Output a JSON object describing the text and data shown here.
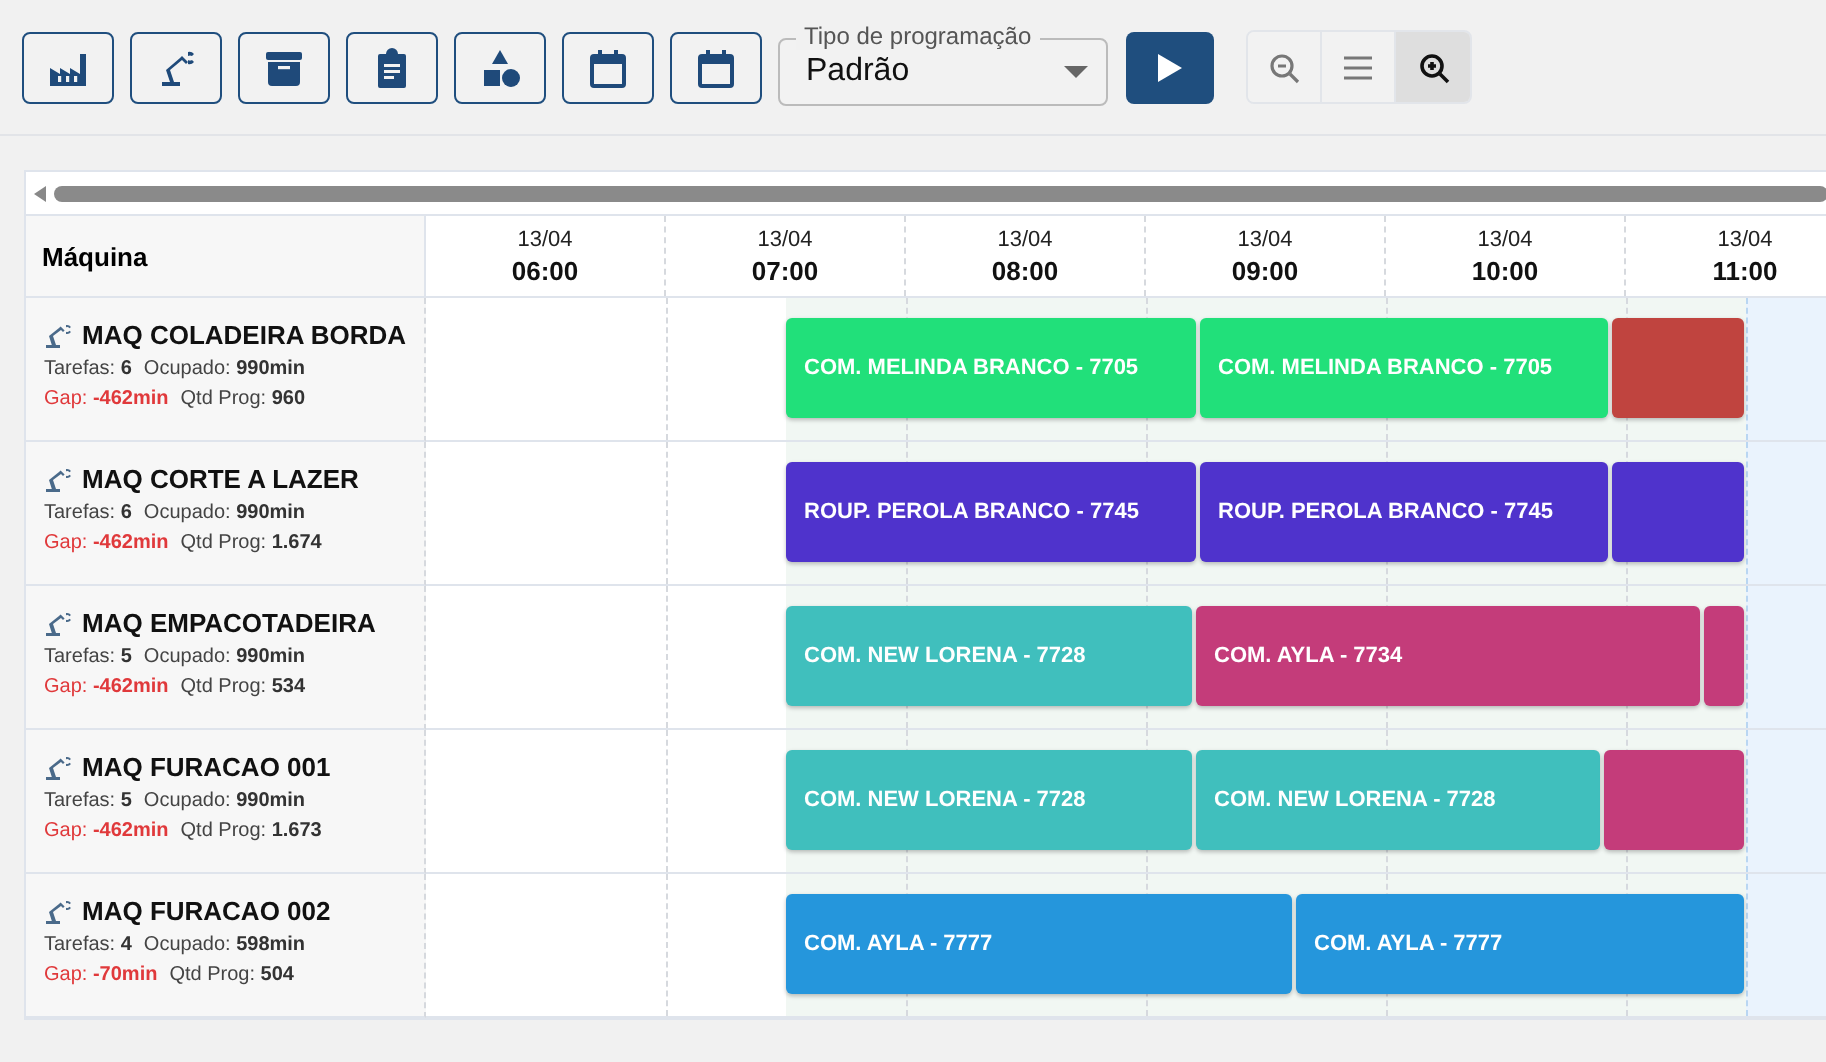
{
  "toolbar": {
    "select": {
      "label": "Tipo de programação",
      "value": "Padrão"
    },
    "zoom": [
      {
        "selected": false
      },
      {
        "selected": false
      },
      {
        "selected": true
      }
    ]
  },
  "gantt": {
    "column_header": "Máquina",
    "times": [
      {
        "date": "13/04",
        "time": "06:00"
      },
      {
        "date": "13/04",
        "time": "07:00"
      },
      {
        "date": "13/04",
        "time": "08:00"
      },
      {
        "date": "13/04",
        "time": "09:00"
      },
      {
        "date": "13/04",
        "time": "10:00"
      },
      {
        "date": "13/04",
        "time": "11:00"
      }
    ],
    "rows": [
      {
        "name": "MAQ COLADEIRA BORDA",
        "stats": [
          {
            "label": "Tarefas:",
            "value": "6",
            "alert": false
          },
          {
            "label": "Ocupado:",
            "value": "990min",
            "alert": false
          },
          {
            "label": "Gap:",
            "value": "-462min",
            "alert": true
          },
          {
            "label": "Qtd Prog:",
            "value": "960",
            "alert": false
          }
        ],
        "tasks": [
          {
            "label": "COM. MELINDA BRANCO - 7705",
            "color": "#21e07a"
          },
          {
            "label": "COM. MELINDA BRANCO - 7705",
            "color": "#21e07a"
          },
          {
            "color": "#c0443f"
          }
        ]
      },
      {
        "name": "MAQ CORTE A LAZER",
        "stats": [
          {
            "label": "Tarefas:",
            "value": "6",
            "alert": false
          },
          {
            "label": "Ocupado:",
            "value": "990min",
            "alert": false
          },
          {
            "label": "Gap:",
            "value": "-462min",
            "alert": true
          },
          {
            "label": "Qtd Prog:",
            "value": "1.674",
            "alert": false
          }
        ],
        "tasks": [
          {
            "label": "ROUP. PEROLA BRANCO - 7745",
            "color": "#4f33cc"
          },
          {
            "label": "ROUP. PEROLA BRANCO - 7745",
            "color": "#4f33cc"
          },
          {
            "color": "#4f33cc"
          }
        ]
      },
      {
        "name": "MAQ EMPACOTADEIRA",
        "stats": [
          {
            "label": "Tarefas:",
            "value": "5",
            "alert": false
          },
          {
            "label": "Ocupado:",
            "value": "990min",
            "alert": false
          },
          {
            "label": "Gap:",
            "value": "-462min",
            "alert": true
          },
          {
            "label": "Qtd Prog:",
            "value": "534",
            "alert": false
          }
        ],
        "tasks": [
          {
            "label": "COM. NEW LORENA - 7728",
            "color": "#40bfbd"
          },
          {
            "label": "COM. AYLA - 7734",
            "color": "#c43c7a"
          },
          {
            "color": "#c43c7a"
          }
        ]
      },
      {
        "name": "MAQ FURACAO 001",
        "stats": [
          {
            "label": "Tarefas:",
            "value": "5",
            "alert": false
          },
          {
            "label": "Ocupado:",
            "value": "990min",
            "alert": false
          },
          {
            "label": "Gap:",
            "value": "-462min",
            "alert": true
          },
          {
            "label": "Qtd Prog:",
            "value": "1.673",
            "alert": false
          }
        ],
        "tasks": [
          {
            "label": "COM. NEW LORENA - 7728",
            "color": "#40bfbd"
          },
          {
            "label": "COM. NEW LORENA - 7728",
            "color": "#40bfbd"
          },
          {
            "color": "#c43c7a"
          }
        ]
      },
      {
        "name": "MAQ FURACAO 002",
        "stats": [
          {
            "label": "Tarefas:",
            "value": "4",
            "alert": false
          },
          {
            "label": "Ocupado:",
            "value": "598min",
            "alert": false
          },
          {
            "label": "Gap:",
            "value": "-70min",
            "alert": true
          },
          {
            "label": "Qtd Prog:",
            "value": "504",
            "alert": false
          }
        ],
        "tasks": [
          {
            "label": "COM. AYLA - 7777",
            "color": "#2596dc"
          },
          {
            "label": "COM. AYLA - 7777",
            "color": "#2596dc"
          }
        ]
      }
    ]
  }
}
